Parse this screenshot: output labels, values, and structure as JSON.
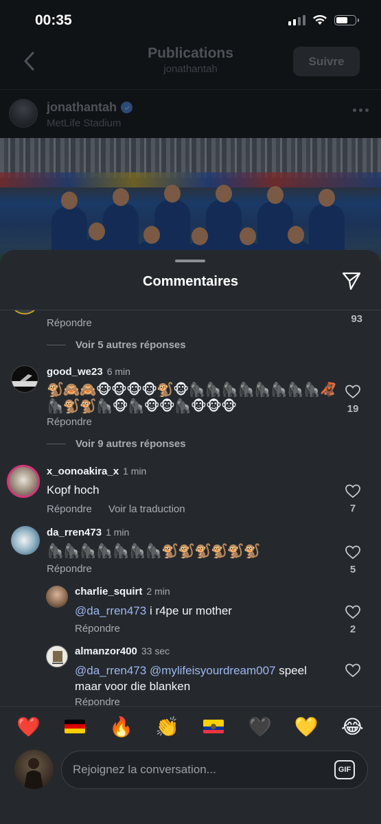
{
  "status_bar": {
    "time": "00:35"
  },
  "header": {
    "title": "Publications",
    "subtitle": "jonathantah",
    "follow_label": "Suivre"
  },
  "post": {
    "username": "jonathantah",
    "location": "MetLife Stadium"
  },
  "sheet": {
    "title": "Commentaires"
  },
  "comments": [
    {
      "reply_label": "Répondre",
      "like_count": "93",
      "view_replies": "Voir 5 autres réponses"
    },
    {
      "username": "good_we23",
      "time": "6 min",
      "text": "🐒🙈🙈🐵🐵🐵🐵🐒🐵🦍🦍🦍🦍🦍🦍🦍🦍🦧🦍🐒🐒🦍🐵🦍🐵🐵🦍🐵🐵🐵",
      "reply_label": "Répondre",
      "like_count": "19",
      "view_replies": "Voir 9 autres réponses"
    },
    {
      "username": "x_oonoakira_x",
      "time": "1 min",
      "text": "Kopf hoch",
      "reply_label": "Répondre",
      "translate_label": "Voir la traduction",
      "like_count": "7"
    },
    {
      "username": "da_rren473",
      "time": "1 min",
      "text": "🦍🦍🦍🦍🦍🦍🦍🐒🐒🐒🐒🐒🐒",
      "reply_label": "Répondre",
      "like_count": "5",
      "replies": [
        {
          "username": "charlie_squirt",
          "time": "2 min",
          "mention": "@da_rren473",
          "text": " i r4pe ur mother",
          "reply_label": "Répondre",
          "like_count": "2"
        },
        {
          "username": "almanzor400",
          "time": "33 sec",
          "mention": "@da_rren473",
          "mention2": "@mylifeisyourdream007",
          "text": " speel maar voor die blanken",
          "reply_label": "Répondre"
        }
      ]
    }
  ],
  "reactions": [
    "❤️",
    "flag-germany",
    "🔥",
    "👏",
    "flag-ecuador",
    "🖤",
    "💛",
    "😂"
  ],
  "input": {
    "placeholder": "Rejoignez la conversation...",
    "gif_label": "GIF"
  }
}
